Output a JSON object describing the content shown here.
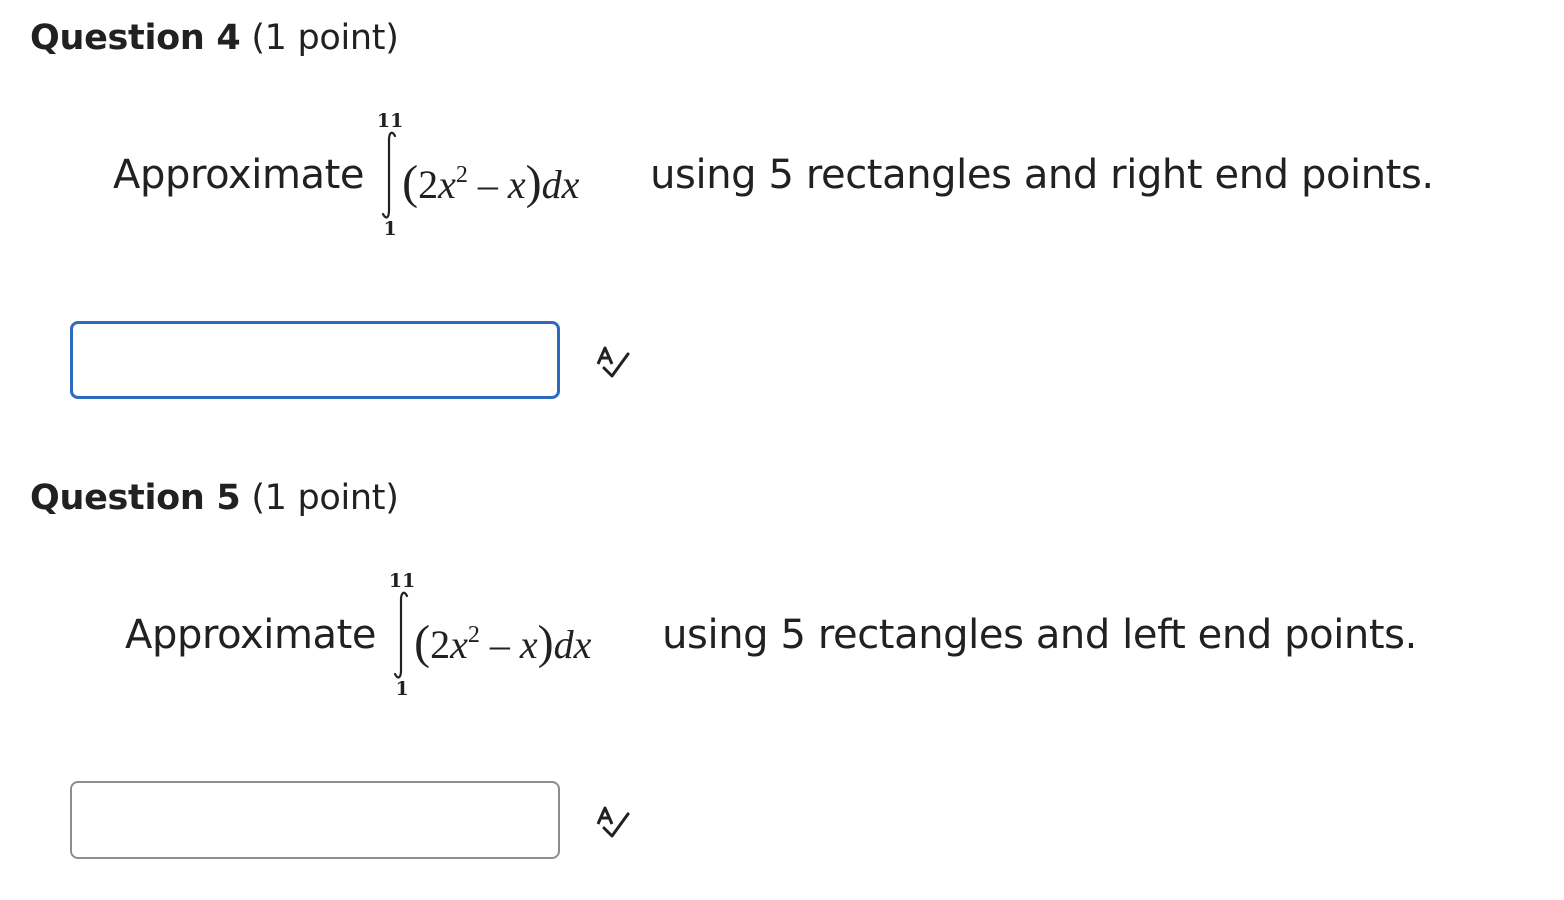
{
  "questions": [
    {
      "title": "Question 4",
      "points": "(1 point)",
      "prompt_before": "Approximate",
      "integral": {
        "upper": "11",
        "lower": "1",
        "open": "(",
        "coef": "2",
        "var": "x",
        "power": "2",
        "minus": "–",
        "var2": "x",
        "close": ")",
        "diff": "dx"
      },
      "prompt_after": "using 5 rectangles and right end points.",
      "answer_value": "",
      "spell_check_icon": "spell-check-icon"
    },
    {
      "title": "Question 5",
      "points": "(1 point)",
      "prompt_before": "Approximate",
      "integral": {
        "upper": "11",
        "lower": "1",
        "open": "(",
        "coef": "2",
        "var": "x",
        "power": "2",
        "minus": "–",
        "var2": "x",
        "close": ")",
        "diff": "dx"
      },
      "prompt_after": "using 5 rectangles and left end points.",
      "answer_value": "",
      "spell_check_icon": "spell-check-icon"
    }
  ],
  "colors": {
    "focus_border": "#2d6bbf",
    "input_border": "#8a8d91",
    "text": "#202122"
  }
}
